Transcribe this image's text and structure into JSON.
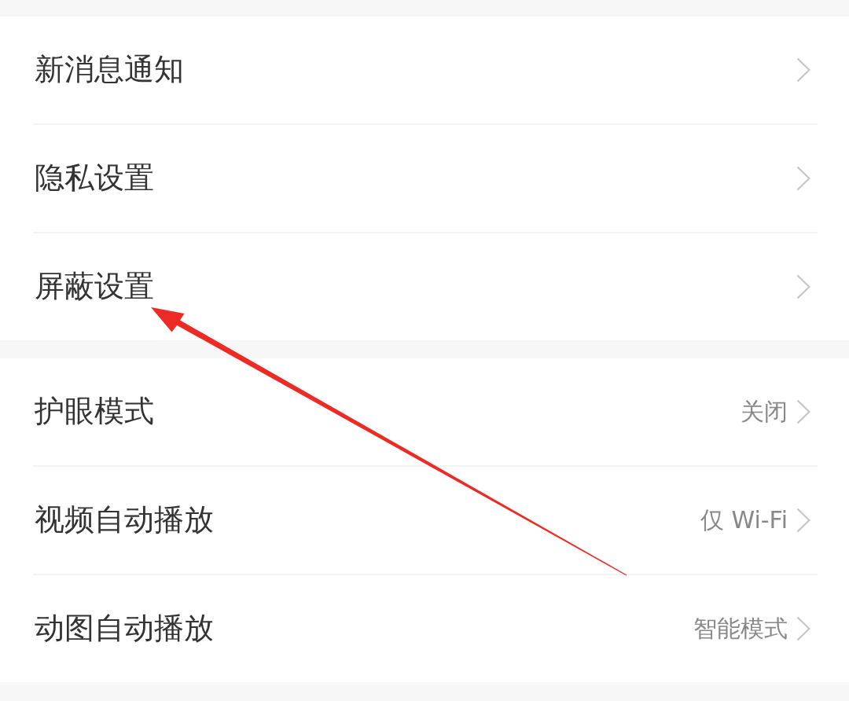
{
  "groups": [
    {
      "items": [
        {
          "label": "新消息通知"
        },
        {
          "label": "隐私设置"
        },
        {
          "label": "屏蔽设置"
        }
      ]
    },
    {
      "items": [
        {
          "label": "护眼模式",
          "value": "关闭"
        },
        {
          "label": "视频自动播放",
          "value": "仅 Wi-Fi"
        },
        {
          "label": "动图自动播放",
          "value": "智能模式"
        }
      ]
    }
  ]
}
